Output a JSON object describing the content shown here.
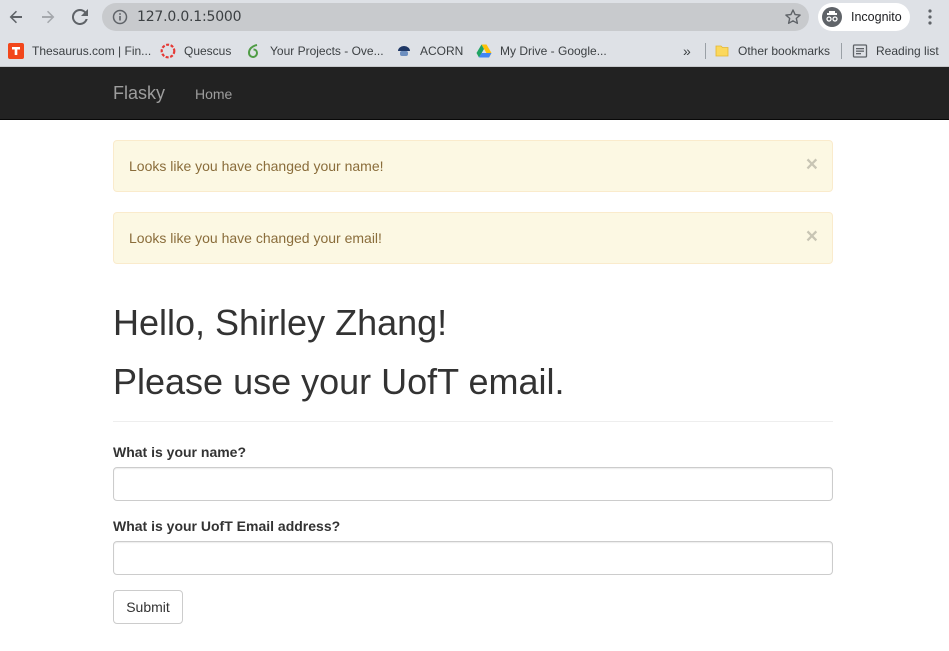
{
  "browser": {
    "url": "127.0.0.1:5000",
    "profile_label": "Incognito",
    "bookmarks": [
      {
        "label": "Thesaurus.com | Fin...",
        "icon": "thesaurus-icon",
        "color": "#f2461b"
      },
      {
        "label": "Quescus",
        "icon": "quercus-icon",
        "color": "#e53935"
      },
      {
        "label": "Your Projects - Ove...",
        "icon": "overleaf-icon",
        "color": "#4f9c45"
      },
      {
        "label": "ACORN",
        "icon": "acorn-icon",
        "color": "#1e3765"
      },
      {
        "label": "My Drive - Google...",
        "icon": "google-drive-icon",
        "color": "#1fa463"
      }
    ],
    "overflow_label": "»",
    "other_bookmarks_label": "Other bookmarks",
    "reading_list_label": "Reading list"
  },
  "navbar": {
    "brand": "Flasky",
    "links": [
      {
        "label": "Home"
      }
    ]
  },
  "alerts": [
    {
      "message": "Looks like you have changed your name!",
      "close": "×"
    },
    {
      "message": "Looks like you have changed your email!",
      "close": "×"
    }
  ],
  "header": {
    "greeting": "Hello, Shirley Zhang!",
    "notice": "Please use your UofT email."
  },
  "form": {
    "name_label": "What is your name?",
    "name_value": "",
    "email_label": "What is your UofT Email address?",
    "email_value": "",
    "submit_label": "Submit"
  }
}
